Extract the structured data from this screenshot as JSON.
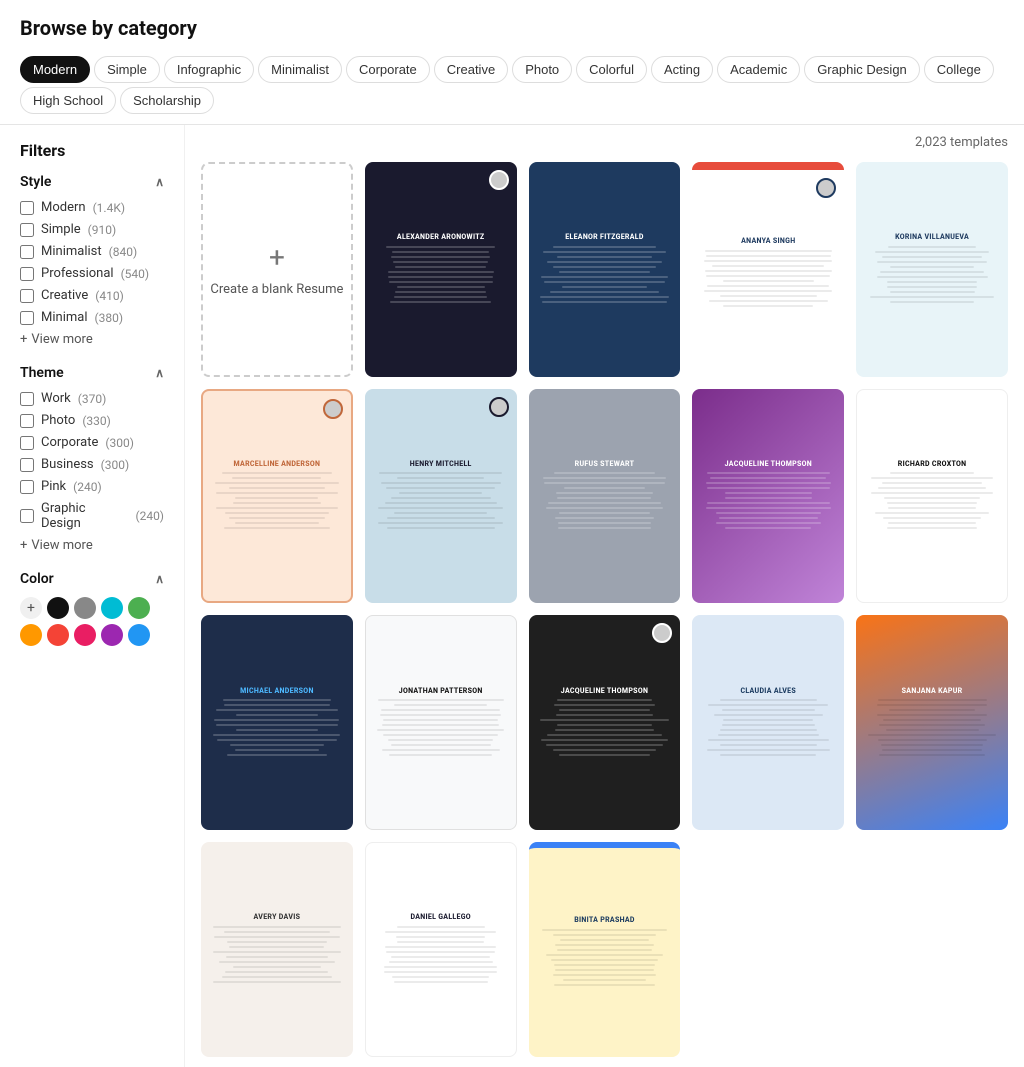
{
  "page": {
    "title": "Browse by category"
  },
  "categories": [
    {
      "id": "modern",
      "label": "Modern",
      "active": true
    },
    {
      "id": "simple",
      "label": "Simple",
      "active": false
    },
    {
      "id": "infographic",
      "label": "Infographic",
      "active": false
    },
    {
      "id": "minimalist",
      "label": "Minimalist",
      "active": false
    },
    {
      "id": "corporate",
      "label": "Corporate",
      "active": false
    },
    {
      "id": "creative",
      "label": "Creative",
      "active": false
    },
    {
      "id": "photo",
      "label": "Photo",
      "active": false
    },
    {
      "id": "colorful",
      "label": "Colorful",
      "active": false
    },
    {
      "id": "acting",
      "label": "Acting",
      "active": false
    },
    {
      "id": "academic",
      "label": "Academic",
      "active": false
    },
    {
      "id": "graphic-design",
      "label": "Graphic Design",
      "active": false
    },
    {
      "id": "college",
      "label": "College",
      "active": false
    },
    {
      "id": "high-school",
      "label": "High School",
      "active": false
    },
    {
      "id": "scholarship",
      "label": "Scholarship",
      "active": false
    }
  ],
  "filters": {
    "title": "Filters",
    "template_count": "2,023 templates",
    "style": {
      "label": "Style",
      "items": [
        {
          "label": "Modern",
          "count": "(1.4K)",
          "checked": false
        },
        {
          "label": "Simple",
          "count": "(910)",
          "checked": false
        },
        {
          "label": "Minimalist",
          "count": "(840)",
          "checked": false
        },
        {
          "label": "Professional",
          "count": "(540)",
          "checked": false
        },
        {
          "label": "Creative",
          "count": "(410)",
          "checked": false
        },
        {
          "label": "Minimal",
          "count": "(380)",
          "checked": false
        }
      ],
      "view_more": "View more"
    },
    "theme": {
      "label": "Theme",
      "items": [
        {
          "label": "Work",
          "count": "(370)",
          "checked": false
        },
        {
          "label": "Photo",
          "count": "(330)",
          "checked": false
        },
        {
          "label": "Corporate",
          "count": "(300)",
          "checked": false
        },
        {
          "label": "Business",
          "count": "(300)",
          "checked": false
        },
        {
          "label": "Pink",
          "count": "(240)",
          "checked": false
        },
        {
          "label": "Graphic Design",
          "count": "(240)",
          "checked": false
        }
      ],
      "view_more": "View more"
    },
    "color": {
      "label": "Color",
      "swatches": [
        {
          "color": "#ffffff",
          "type": "add"
        },
        {
          "color": "#111111"
        },
        {
          "color": "#888888"
        },
        {
          "color": "#00bcd4"
        },
        {
          "color": "#4caf50"
        },
        {
          "color": "#ff9800"
        },
        {
          "color": "#f44336"
        },
        {
          "color": "#e91e63"
        },
        {
          "color": "#9c27b0"
        },
        {
          "color": "#2196f3"
        }
      ]
    }
  },
  "create_blank": {
    "plus": "+",
    "label": "Create a blank Resume"
  },
  "templates": [
    {
      "id": "t1",
      "name": "Alexander Aronowitz",
      "style": "dark"
    },
    {
      "id": "t2",
      "name": "Eleanor Fitzgerald",
      "style": "blue"
    },
    {
      "id": "t3",
      "name": "Ananya Singh",
      "style": "red-accent"
    },
    {
      "id": "t4",
      "name": "Korina Villanueva",
      "style": "teal"
    },
    {
      "id": "t5",
      "name": "Marcelline Anderson",
      "style": "peach"
    },
    {
      "id": "t6",
      "name": "Henry Mitchell",
      "style": "light"
    },
    {
      "id": "t7",
      "name": "Rufus Stewart",
      "style": "gray"
    },
    {
      "id": "t8",
      "name": "Jacqueline Thompson",
      "style": "purple"
    },
    {
      "id": "t9",
      "name": "Richard Croxton",
      "style": "white"
    },
    {
      "id": "t10",
      "name": "Michael Anderson",
      "style": "navy"
    },
    {
      "id": "t11",
      "name": "Jonathan Patterson",
      "style": "white2"
    },
    {
      "id": "t12",
      "name": "Jacqueline Thompson",
      "style": "dark2"
    },
    {
      "id": "t13",
      "name": "Claudia Alves",
      "style": "light2"
    },
    {
      "id": "t14",
      "name": "Sanjana Kapur",
      "style": "colorful"
    },
    {
      "id": "t15",
      "name": "Avery Davis",
      "style": "minimal"
    },
    {
      "id": "t16",
      "name": "Daniel Gallego",
      "style": "white3"
    },
    {
      "id": "t17",
      "name": "Binita Prashad",
      "style": "yellow"
    }
  ]
}
